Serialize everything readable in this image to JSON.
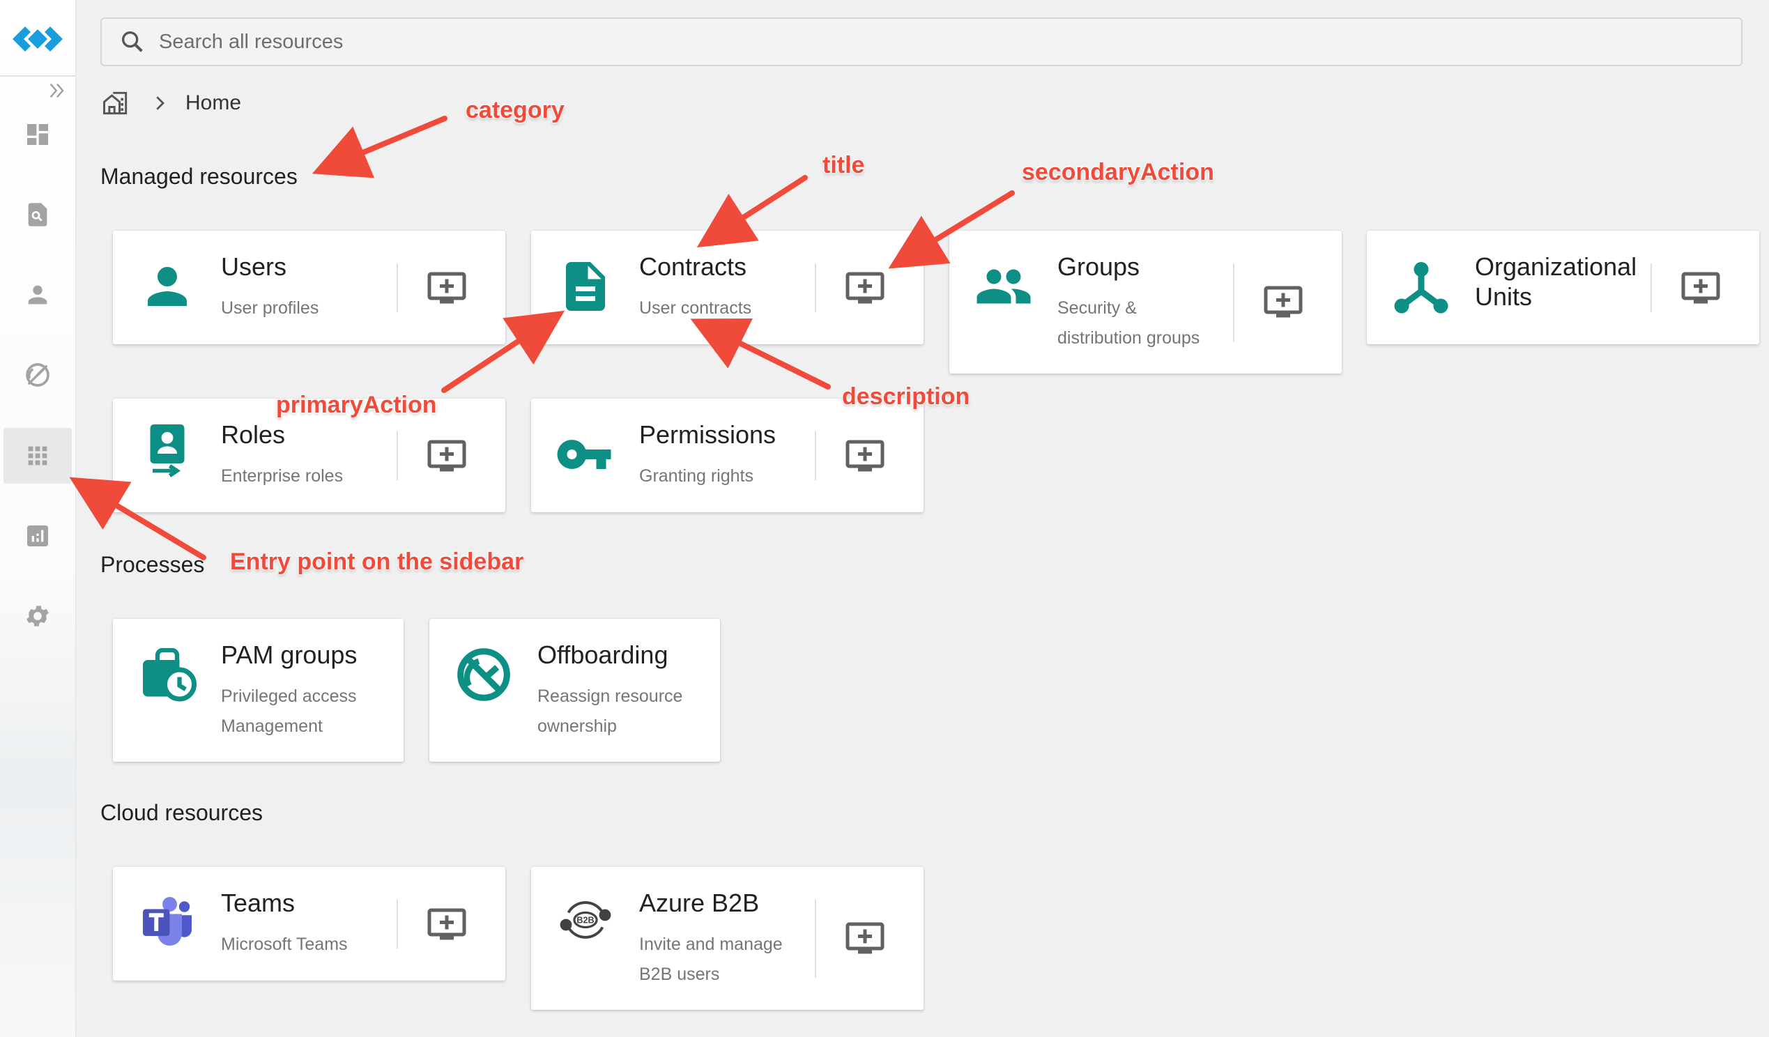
{
  "search": {
    "placeholder": "Search all resources"
  },
  "breadcrumb": {
    "current": "Home"
  },
  "sidebar": {
    "items": [
      {
        "icon": "dashboard-icon"
      },
      {
        "icon": "search-document-icon"
      },
      {
        "icon": "person-icon"
      },
      {
        "icon": "speed-icon"
      },
      {
        "icon": "apps-grid-icon",
        "active": true
      },
      {
        "icon": "analytics-icon"
      },
      {
        "icon": "settings-icon"
      }
    ]
  },
  "categories": [
    {
      "label": "Managed resources",
      "cards": [
        {
          "title": "Users",
          "description": "User profiles",
          "icon": "person-icon"
        },
        {
          "title": "Contracts",
          "description": "User contracts",
          "icon": "document-icon"
        },
        {
          "title": "Groups",
          "description": "Security & distribution groups",
          "desc_lines": [
            "Security &",
            "distribution groups"
          ],
          "icon": "groups-icon"
        },
        {
          "title": "Organizational Units",
          "title_lines": [
            "Organizational",
            "Units"
          ],
          "description": "",
          "icon": "org-unit-icon"
        },
        {
          "title": "Roles",
          "description": "Enterprise roles",
          "icon": "badge-icon"
        },
        {
          "title": "Permissions",
          "description": "Granting rights",
          "icon": "key-icon"
        }
      ]
    },
    {
      "label": "Processes",
      "cards": [
        {
          "title": "PAM groups",
          "description": "Privileged access Management",
          "desc_lines": [
            "Privileged access",
            "Management"
          ],
          "icon": "work-history-icon"
        },
        {
          "title": "Offboarding",
          "description": "Reassign resource ownership",
          "desc_lines": [
            "Reassign resource",
            "ownership"
          ],
          "icon": "speed-off-icon"
        }
      ]
    },
    {
      "label": "Cloud resources",
      "cards": [
        {
          "title": "Teams",
          "description": "Microsoft Teams",
          "icon": "teams-icon"
        },
        {
          "title": "Azure B2B",
          "description": "Invite and manage B2B users",
          "desc_lines": [
            "Invite and manage",
            "B2B users"
          ],
          "icon": "b2b-icon"
        }
      ]
    }
  ],
  "secondary_action_icon": "add-to-queue-icon",
  "annotations": {
    "category": "category",
    "title": "title",
    "secondaryAction": "secondaryAction",
    "primaryAction": "primaryAction",
    "description": "description",
    "entry_point": "Entry point on the sidebar"
  },
  "colors": {
    "accent": "#0d8f86",
    "annotation": "#f04a3a",
    "logo": "#1a9ddc",
    "teams": "#5059c9",
    "sidebar_icon": "#a3a3a3"
  }
}
